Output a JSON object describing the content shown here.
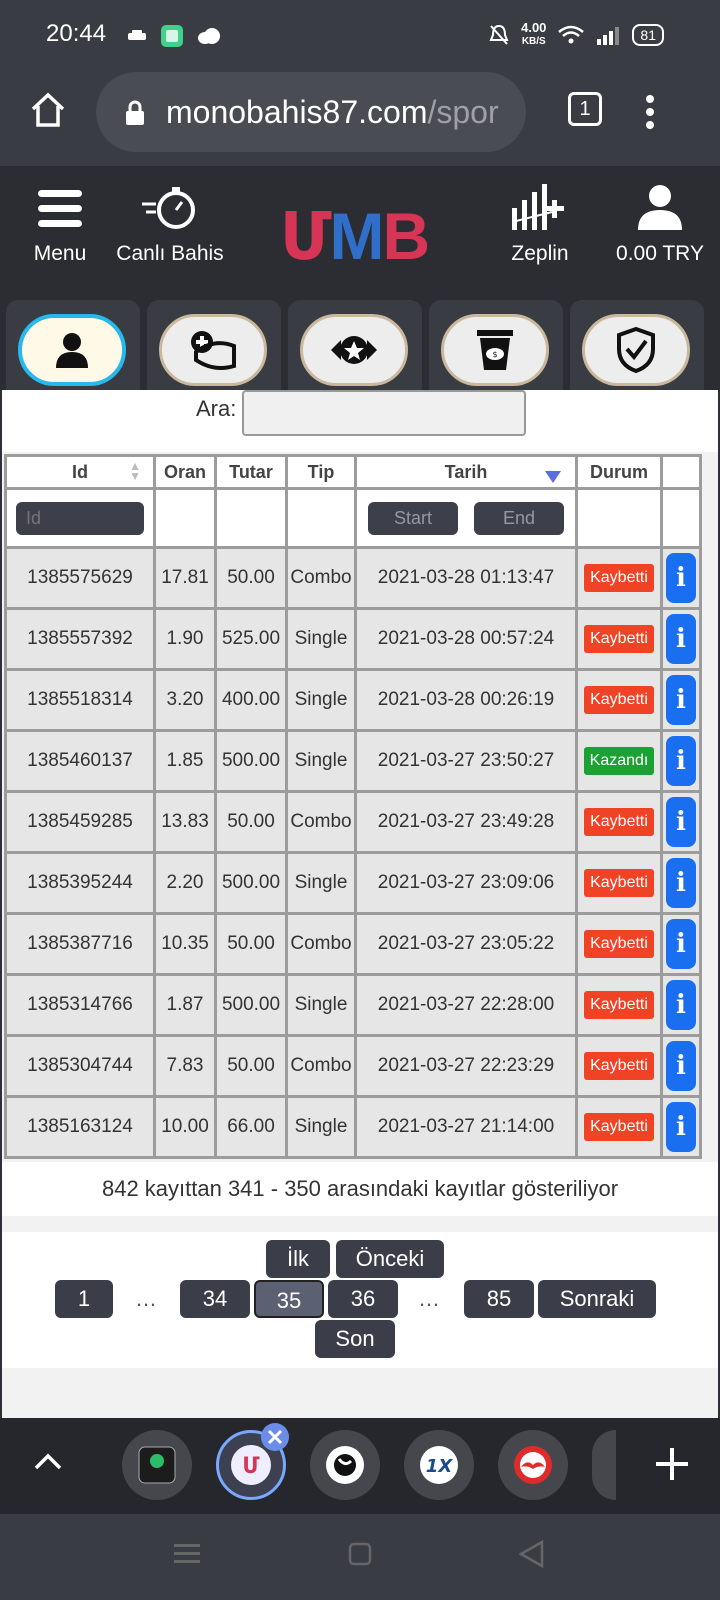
{
  "status_bar": {
    "time": "20:44",
    "net_speed_value": "4.00",
    "net_speed_unit": "KB/S",
    "battery": "81"
  },
  "browser": {
    "url_main": "monobahis87.com",
    "url_path": "/spor",
    "tab_count": "1"
  },
  "site_header": {
    "menu_label": "Menu",
    "live_label": "Canlı Bahis",
    "logo": {
      "part1": "Մ",
      "part2": "M",
      "part3": "B"
    },
    "zeplin_label": "Zeplin",
    "balance_label": "0.00 TRY"
  },
  "search": {
    "label": "Ara:",
    "value": ""
  },
  "table": {
    "headers": {
      "id": "Id",
      "oran": "Oran",
      "tutar": "Tutar",
      "tip": "Tip",
      "tarih": "Tarih",
      "durum": "Durum"
    },
    "filters": {
      "id_placeholder": "Id",
      "start": "Start",
      "end": "End"
    },
    "rows": [
      {
        "id": "1385575629",
        "oran": "17.81",
        "tutar": "50.00",
        "tip": "Combo",
        "tarih": "2021-03-28 01:13:47",
        "durum": "Kaybetti",
        "status": "lost"
      },
      {
        "id": "1385557392",
        "oran": "1.90",
        "tutar": "525.00",
        "tip": "Single",
        "tarih": "2021-03-28 00:57:24",
        "durum": "Kaybetti",
        "status": "lost"
      },
      {
        "id": "1385518314",
        "oran": "3.20",
        "tutar": "400.00",
        "tip": "Single",
        "tarih": "2021-03-28 00:26:19",
        "durum": "Kaybetti",
        "status": "lost"
      },
      {
        "id": "1385460137",
        "oran": "1.85",
        "tutar": "500.00",
        "tip": "Single",
        "tarih": "2021-03-27 23:50:27",
        "durum": "Kazandı",
        "status": "won"
      },
      {
        "id": "1385459285",
        "oran": "13.83",
        "tutar": "50.00",
        "tip": "Combo",
        "tarih": "2021-03-27 23:49:28",
        "durum": "Kaybetti",
        "status": "lost"
      },
      {
        "id": "1385395244",
        "oran": "2.20",
        "tutar": "500.00",
        "tip": "Single",
        "tarih": "2021-03-27 23:09:06",
        "durum": "Kaybetti",
        "status": "lost"
      },
      {
        "id": "1385387716",
        "oran": "10.35",
        "tutar": "50.00",
        "tip": "Combo",
        "tarih": "2021-03-27 23:05:22",
        "durum": "Kaybetti",
        "status": "lost"
      },
      {
        "id": "1385314766",
        "oran": "1.87",
        "tutar": "500.00",
        "tip": "Single",
        "tarih": "2021-03-27 22:28:00",
        "durum": "Kaybetti",
        "status": "lost"
      },
      {
        "id": "1385304744",
        "oran": "7.83",
        "tutar": "50.00",
        "tip": "Combo",
        "tarih": "2021-03-27 22:23:29",
        "durum": "Kaybetti",
        "status": "lost"
      },
      {
        "id": "1385163124",
        "oran": "10.00",
        "tutar": "66.00",
        "tip": "Single",
        "tarih": "2021-03-27 21:14:00",
        "durum": "Kaybetti",
        "status": "lost"
      }
    ],
    "info_glyph": "i"
  },
  "summary": "842 kayıttan 341 - 350 arasındaki kayıtlar gösteriliyor",
  "pagination": {
    "first": "İlk",
    "prev": "Önceki",
    "next": "Sonraki",
    "last": "Son",
    "p1": "1",
    "p34": "34",
    "p35": "35",
    "p36": "36",
    "p85": "85",
    "ellipsis": "…"
  },
  "colors": {
    "lost": "#f04224",
    "won": "#1aa332",
    "info": "#1a6ff0",
    "header_bg": "#2b2d33"
  },
  "icons": [
    "home-icon",
    "lock-icon",
    "menu-icon",
    "stopwatch-icon",
    "zeplin-chart-icon",
    "user-icon",
    "shield-icon"
  ]
}
